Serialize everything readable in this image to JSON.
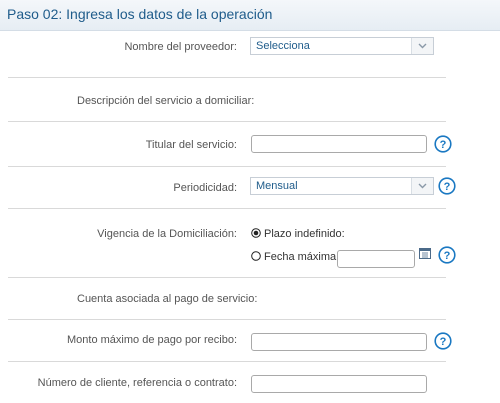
{
  "header": {
    "title": "Paso 02: Ingresa los datos de la operación"
  },
  "form": {
    "provider": {
      "label": "Nombre del proveedor:",
      "value": "Selecciona"
    },
    "service_description": {
      "label": "Descripción del servicio a domiciliar:"
    },
    "service_holder": {
      "label": "Titular del servicio:",
      "value": ""
    },
    "periodicity": {
      "label": "Periodicidad:",
      "value": "Mensual"
    },
    "validity": {
      "label": "Vigencia de la Domiciliación:",
      "options": [
        "Plazo indefinido:",
        "Fecha máxima:"
      ],
      "selected": "Plazo indefinido:",
      "max_date_value": ""
    },
    "linked_account": {
      "label": "Cuenta asociada al pago de servicio:"
    },
    "max_amount": {
      "label": "Monto máximo de pago por recibo:",
      "value": ""
    },
    "client_number": {
      "label": "Número de cliente, referencia o contrato:",
      "value": ""
    }
  },
  "icons": {
    "help": "question-mark-circle-icon",
    "calendar": "calendar-icon",
    "dropdown": "chevron-down-icon",
    "radio_on": "radio-selected-icon",
    "radio_off": "radio-unselected-icon"
  },
  "colors": {
    "accent": "#1f5c8b",
    "help_blue": "#1a78c2",
    "label": "#555555",
    "divider": "#d9d9d9"
  }
}
